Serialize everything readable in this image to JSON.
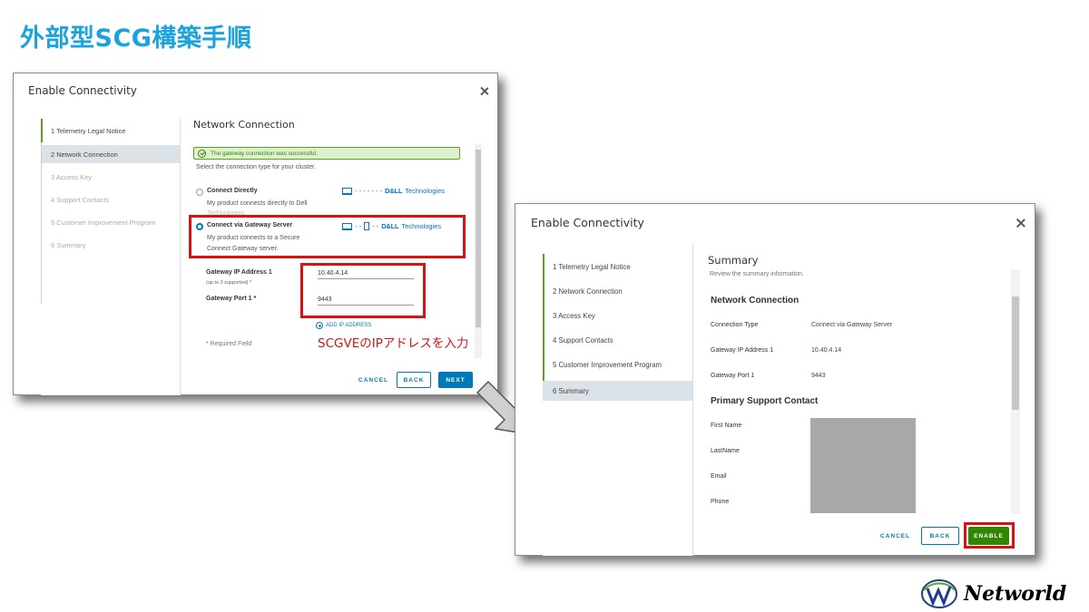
{
  "slide": {
    "title": "外部型SCG構築手順",
    "annotation": "SCGVEのIPアドレスを入力",
    "logo_text": "Networld"
  },
  "dialog1": {
    "title": "Enable Connectivity",
    "nav": [
      {
        "label": "1   Telemetry Legal Notice",
        "state": "done"
      },
      {
        "label": "2   Network Connection",
        "state": "active"
      },
      {
        "label": "3   Access Key",
        "state": "disabled"
      },
      {
        "label": "4   Support Contacts",
        "state": "disabled"
      },
      {
        "label": "5   Customer Improvement Program",
        "state": "disabled"
      },
      {
        "label": "6   Summary",
        "state": "disabled"
      }
    ],
    "section_title": "Network Connection",
    "success_message": "The gateway connection was successful.",
    "instruction": "Select the connection type for your cluster.",
    "option_direct": {
      "title": "Connect Directly",
      "desc1": "My product connects directly to Dell",
      "desc2": "Technologies."
    },
    "option_gateway": {
      "title": "Connect via Gateway Server",
      "desc1": "My product connects to a Secure",
      "desc2": "Connect Gateway server."
    },
    "brand": {
      "dell": "D&LL",
      "tech": "Technologies"
    },
    "gateway_ip_label": "Gateway IP Address 1",
    "gateway_ip_sub": "(up to 3 supported) *",
    "gateway_ip_value": "10.40.4.14",
    "gateway_port_label": "Gateway Port 1 *",
    "gateway_port_value": "9443",
    "add_ip_label": "ADD IP ADDRESS",
    "required_note": "* Required Field",
    "buttons": {
      "cancel": "CANCEL",
      "back": "BACK",
      "next": "NEXT"
    }
  },
  "dialog2": {
    "title": "Enable Connectivity",
    "nav": [
      {
        "label": "1   Telemetry Legal Notice",
        "state": "done"
      },
      {
        "label": "2   Network Connection",
        "state": "done"
      },
      {
        "label": "3   Access Key",
        "state": "done"
      },
      {
        "label": "4   Support Contacts",
        "state": "done"
      },
      {
        "label": "5   Customer Improvement Program",
        "state": "done"
      },
      {
        "label": "6   Summary",
        "state": "active"
      }
    ],
    "section_title": "Summary",
    "subtitle": "Review the summary information.",
    "network_heading": "Network Connection",
    "rows": [
      {
        "label": "Connection Type",
        "value": "Connect via Gateway Server"
      },
      {
        "label": "Gateway IP Address 1",
        "value": "10.40.4.14"
      },
      {
        "label": "Gateway Port 1",
        "value": "9443"
      }
    ],
    "contact_heading": "Primary Support Contact",
    "contact_fields": [
      "First Name",
      "LastName",
      "Email",
      "Phone"
    ],
    "buttons": {
      "cancel": "CANCEL",
      "back": "BACK",
      "enable": "ENABLE"
    }
  }
}
